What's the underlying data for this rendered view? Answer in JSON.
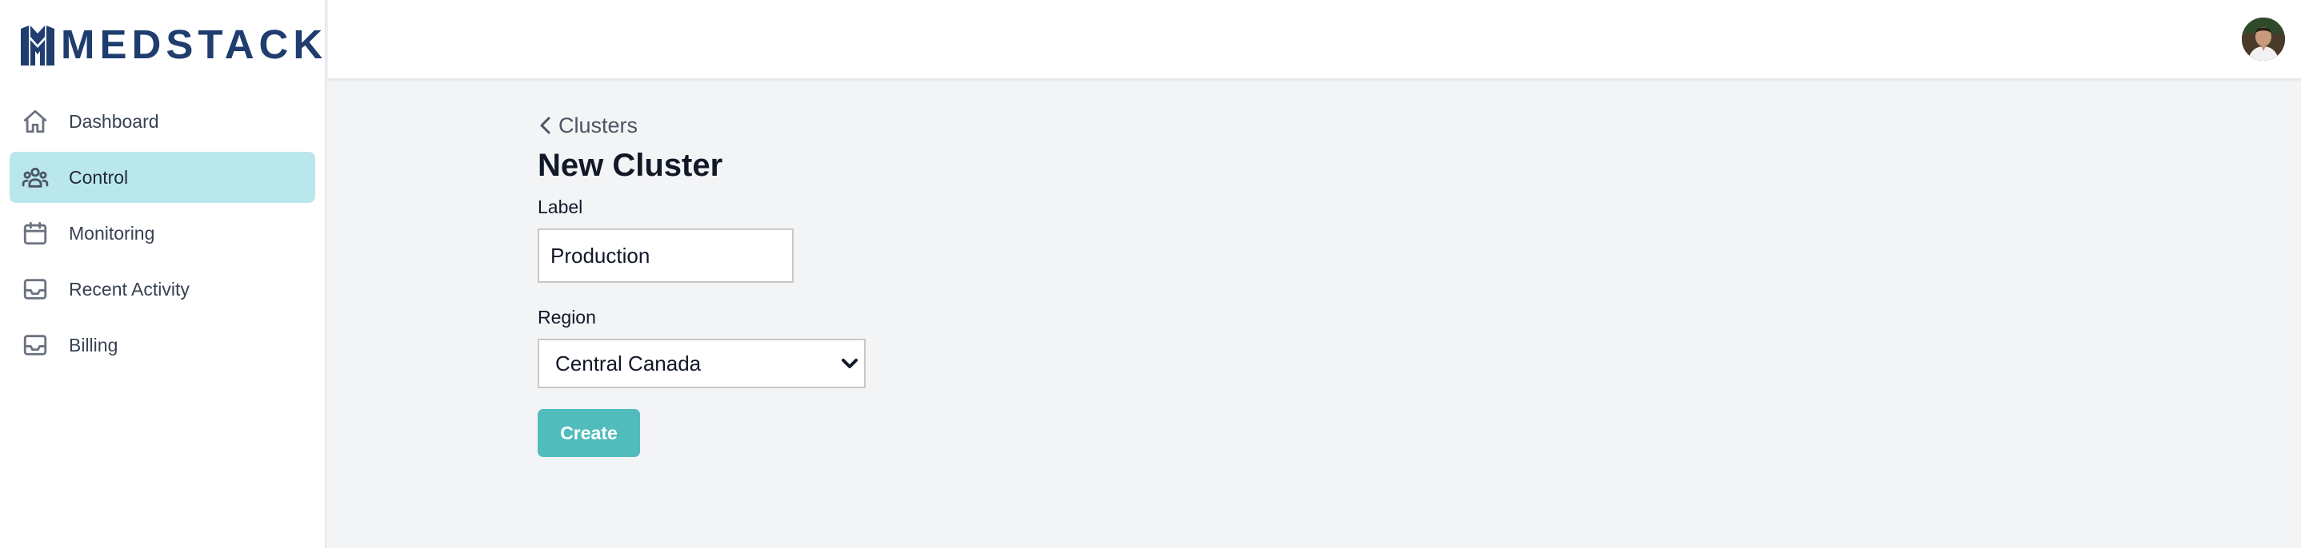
{
  "brand": {
    "name": "MEDSTACK",
    "color": "#1f3d6e"
  },
  "sidebar": {
    "items": [
      {
        "label": "Dashboard",
        "icon": "home-icon",
        "active": false
      },
      {
        "label": "Control",
        "icon": "users-icon",
        "active": true
      },
      {
        "label": "Monitoring",
        "icon": "calendar-icon",
        "active": false
      },
      {
        "label": "Recent Activity",
        "icon": "inbox-icon",
        "active": false
      },
      {
        "label": "Billing",
        "icon": "inbox-icon",
        "active": false
      }
    ],
    "active_color": "#bae7ec"
  },
  "header": {
    "avatar_icon": "user-avatar"
  },
  "main": {
    "breadcrumb": "Clusters",
    "title": "New Cluster",
    "form": {
      "label_field": {
        "label": "Label",
        "value": "Production"
      },
      "region_field": {
        "label": "Region",
        "selected": "Central Canada"
      },
      "submit_label": "Create",
      "submit_color": "#50bcbc"
    }
  }
}
